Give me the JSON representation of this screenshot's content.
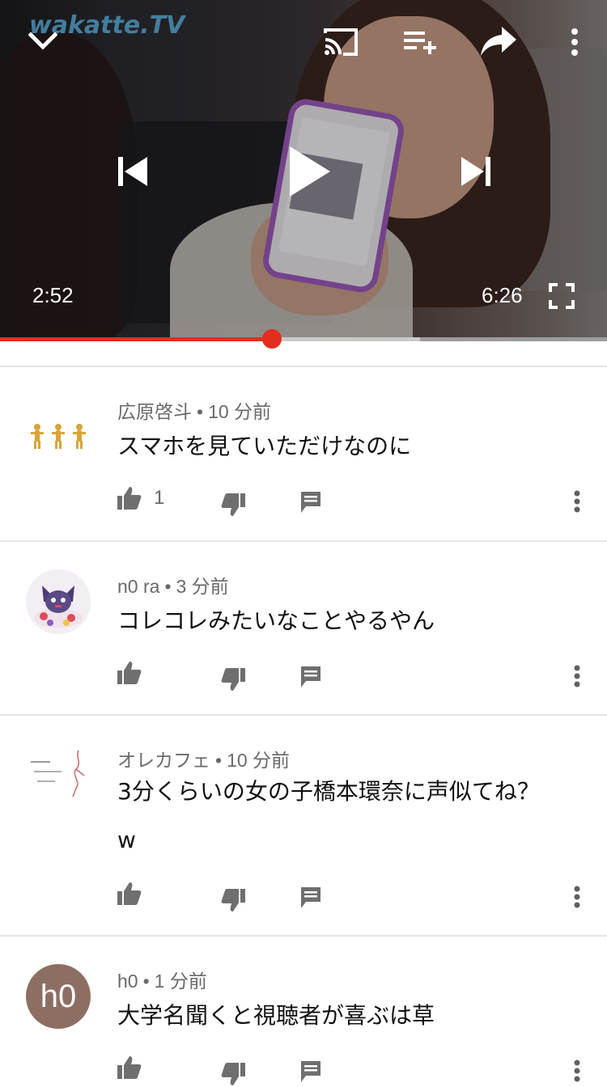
{
  "player": {
    "watermark": "wakatte.TV",
    "current_time": "2:52",
    "duration": "6:26",
    "progress_fraction": 0.448,
    "buffered_fraction": 0.692,
    "icons": {
      "collapse": "chevron-down-icon",
      "cast": "cast-icon",
      "add_to_queue": "playlist-add-icon",
      "share": "share-icon",
      "more": "more-vert-icon",
      "previous": "skip-previous-icon",
      "play": "play-icon",
      "next": "skip-next-icon",
      "fullscreen": "fullscreen-icon"
    },
    "accent_color": "#e32d1f"
  },
  "comments": [
    {
      "author": "広原啓斗",
      "time": "10 分前",
      "text": "スマホを見ていただけなのに",
      "likes": "1",
      "avatar": "walking-figures-avatar"
    },
    {
      "author": "n0 ra",
      "time": "3 分前",
      "text": "コレコレみたいなことやるやん",
      "likes": "",
      "avatar": "character-avatar"
    },
    {
      "author": "オレカフェ",
      "time": "10 分前",
      "text": "3分くらいの女の子橋本環奈に声似てね？\nw",
      "likes": "",
      "avatar": "sketch-avatar"
    },
    {
      "author": "h0",
      "time": "1 分前",
      "text": "大学名聞くと視聴者が喜ぶは草",
      "likes": "",
      "avatar_letter": "h0",
      "avatar_color": "#8d6e63"
    }
  ]
}
